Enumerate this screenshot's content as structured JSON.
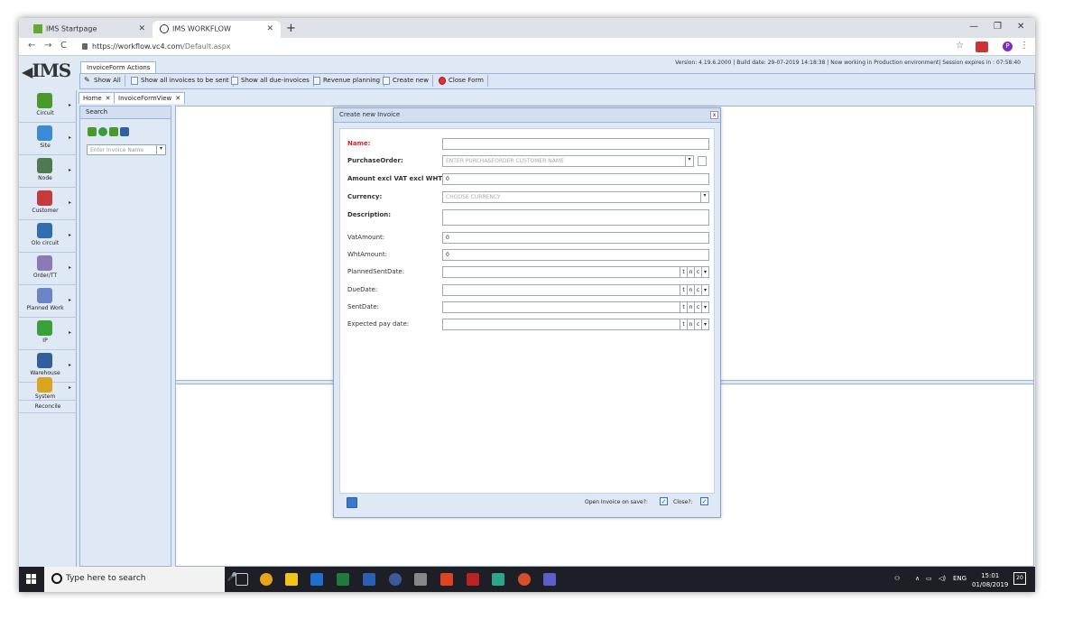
{
  "browser": {
    "tabs": [
      {
        "title": "IMS Startpage"
      },
      {
        "title": "IMS WORKFLOW"
      }
    ],
    "url_host": "https://workflow.vc4.com",
    "url_path": "/Default.aspx"
  },
  "app": {
    "logo": "IMS",
    "actions_tab": "InvoiceForm Actions",
    "version": "Version: 4.19.6.2000 | Build date: 29-07-2019 14:18:38 | Now working in Production environment| Session expires in : 07:58:40",
    "toolbar": [
      {
        "label": "Show All",
        "icon": "pencil-icon"
      },
      {
        "label": "Show all invoices to be sent",
        "icon": "doc-icon"
      },
      {
        "label": "Show all due-invoices",
        "icon": "doc-icon"
      },
      {
        "label": "Revenue planning",
        "icon": "doc-icon"
      },
      {
        "label": "Create new",
        "icon": "doc-icon"
      },
      {
        "label": "Close Form",
        "icon": "close-circle-icon"
      }
    ],
    "nav": [
      {
        "label": "Circuit",
        "color": "#4a9a2a"
      },
      {
        "label": "Site",
        "color": "#3b8bd6"
      },
      {
        "label": "Node",
        "color": "#4f7a4f"
      },
      {
        "label": "Customer",
        "color": "#c43b3b"
      },
      {
        "label": "Olo circuit",
        "color": "#2f6fb0"
      },
      {
        "label": "Order/TT",
        "color": "#8a7bb8"
      },
      {
        "label": "Planned Work",
        "color": "#6a86c7"
      },
      {
        "label": "IP",
        "color": "#3aa13a"
      },
      {
        "label": "Warehouse",
        "color": "#2f5f9f"
      },
      {
        "label": "System",
        "color": "#d9a520"
      }
    ],
    "reconcile": "Reconcile",
    "doc_tabs": [
      "Home",
      "InvoiceFormView"
    ],
    "search": {
      "title": "Search",
      "placeholder": "Enter Invoice Name"
    }
  },
  "dialog": {
    "title": "Create new Invoice",
    "fields": {
      "name_label": "Name:",
      "po_label": "PurchaseOrder:",
      "po_placeholder": "ENTER PURCHASEORDER CUSTOMER NAME",
      "amount_label": "Amount excl VAT excl WHT:",
      "amount_value": "0",
      "currency_label": "Currency:",
      "currency_placeholder": "CHOOSE CURRENCY",
      "description_label": "Description:",
      "vat_label": "VatAmount:",
      "vat_value": "0",
      "wht_label": "WhtAmount:",
      "wht_value": "0",
      "planned_label": "PlannedSentDate:",
      "due_label": "DueDate:",
      "sent_label": "SentDate:",
      "pay_label": "Expected pay date:",
      "date_btn_t": "t",
      "date_btn_n": "n",
      "date_btn_c": "c"
    },
    "footer": {
      "open_label": "Open Invoice on save?:",
      "close_label": "Close?:",
      "open_checked": true,
      "close_checked": true
    }
  },
  "taskbar": {
    "search_placeholder": "Type here to search",
    "lang": "ENG",
    "time": "15:01",
    "date": "01/08/2019",
    "notifications": "20"
  }
}
